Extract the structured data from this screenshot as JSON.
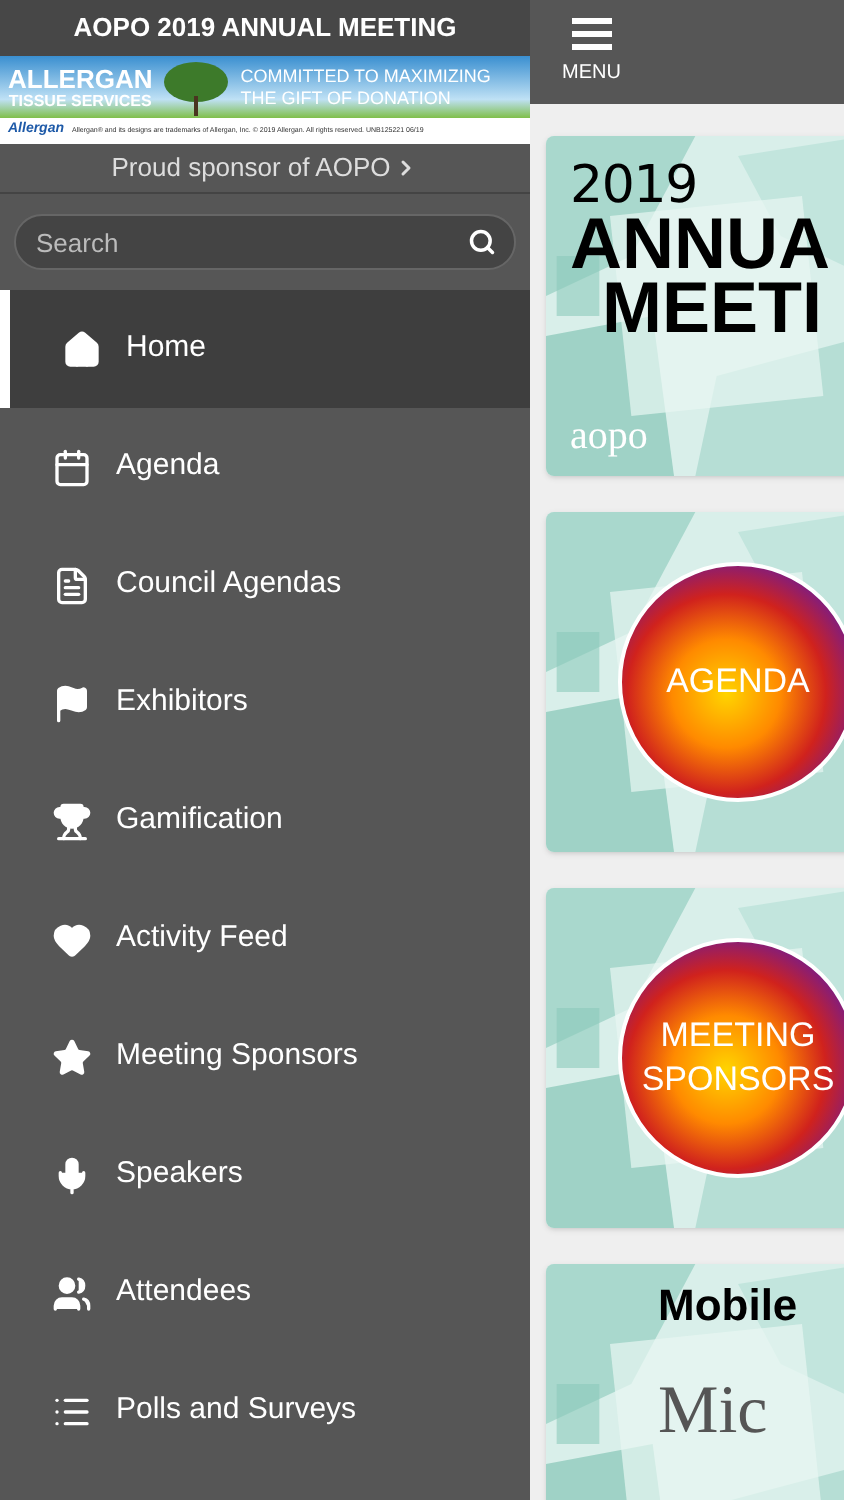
{
  "sidebar": {
    "title": "AOPO 2019 ANNUAL MEETING",
    "banner": {
      "brand": "ALLERGAN",
      "brand_sub": "TISSUE SERVICES",
      "slogan": [
        "COMMITTED TO MAXIMIZING",
        "THE GIFT OF DONATION"
      ],
      "logo": "Allergan",
      "fine_print": "Allergan® and its designs are trademarks of Allergan, Inc. © 2019 Allergan. All rights reserved. UNB125221 06/19"
    },
    "sponsor_link": "Proud sponsor of AOPO",
    "search": {
      "placeholder": "Search"
    },
    "items": [
      {
        "label": "Home",
        "selected": true
      },
      {
        "label": "Agenda",
        "selected": false
      },
      {
        "label": "Council Agendas",
        "selected": false
      },
      {
        "label": "Exhibitors",
        "selected": false
      },
      {
        "label": "Gamification",
        "selected": false
      },
      {
        "label": "Activity Feed",
        "selected": false
      },
      {
        "label": "Meeting Sponsors",
        "selected": false
      },
      {
        "label": "Speakers",
        "selected": false
      },
      {
        "label": "Attendees",
        "selected": false
      },
      {
        "label": "Polls and Surveys",
        "selected": false
      }
    ]
  },
  "header": {
    "menu_label": "MENU"
  },
  "tiles": [
    {
      "kind": "meeting",
      "lines": [
        "2019",
        "ANNUA",
        "MEETI"
      ],
      "brand": "aopo"
    },
    {
      "kind": "circle",
      "lines": [
        "AGENDA"
      ]
    },
    {
      "kind": "circle",
      "lines": [
        "MEETING",
        "SPONSORS"
      ]
    },
    {
      "kind": "mobile",
      "lines": [
        "Mobile",
        "Mic"
      ]
    }
  ]
}
